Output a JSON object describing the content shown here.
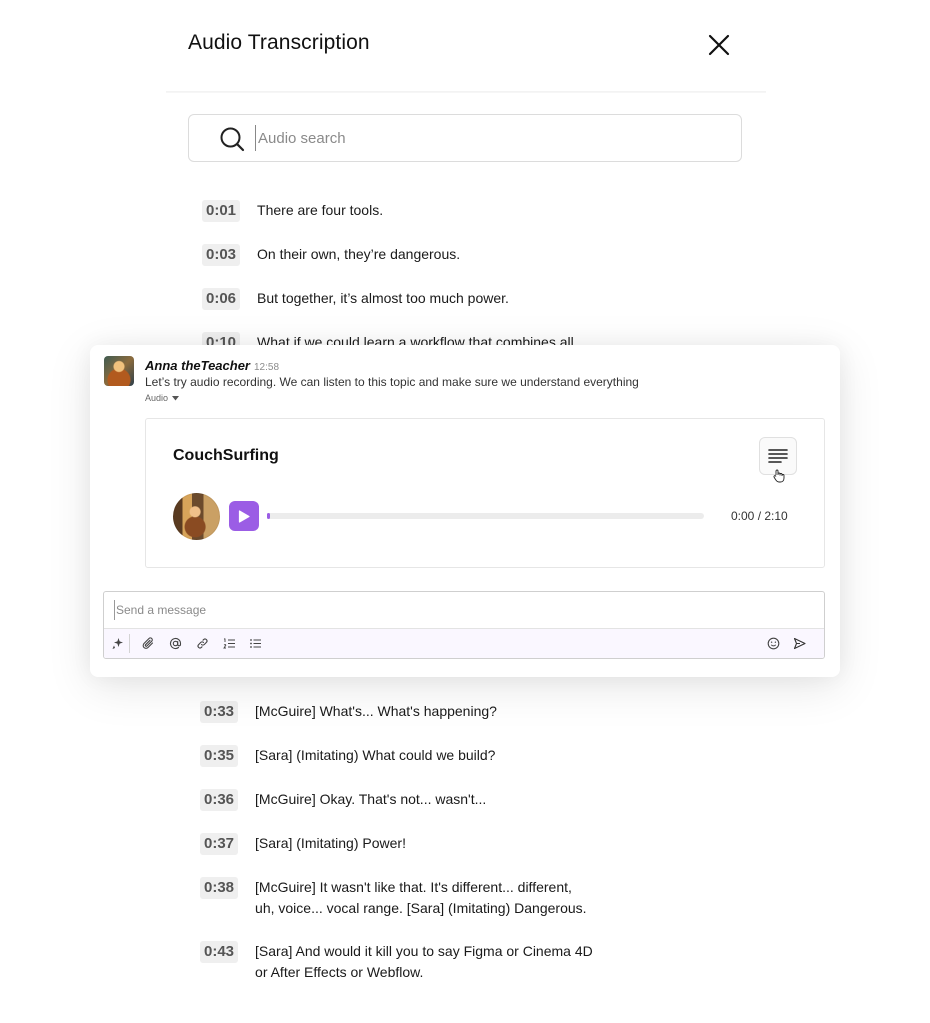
{
  "panel": {
    "title": "Audio Transcription",
    "search_placeholder": "Audio search"
  },
  "transcript_top": [
    {
      "time": "0:01",
      "text": "There are four tools."
    },
    {
      "time": "0:03",
      "text": "On their own, they’re dangerous."
    },
    {
      "time": "0:06",
      "text": "But together, it’s almost too much power."
    },
    {
      "time": "0:10",
      "text": "What if we could learn a workflow that combines all"
    }
  ],
  "transcript_bottom": [
    {
      "time": "0:33",
      "text": "[McGuire] What's... What's happening?"
    },
    {
      "time": "0:35",
      "text": "[Sara] (Imitating) What could we build?"
    },
    {
      "time": "0:36",
      "text": "[McGuire] Okay. That's not... wasn't..."
    },
    {
      "time": "0:37",
      "text": "[Sara] (Imitating) Power!"
    },
    {
      "time": "0:38",
      "text": "[McGuire] It wasn't like that. It's different... different, uh, voice... vocal range. [Sara] (Imitating) Dangerous."
    },
    {
      "time": "0:43",
      "text": "[Sara] And would it kill you to say Figma or Cinema 4D or After Effects or Webflow."
    }
  ],
  "message": {
    "author": "Anna theTeacher",
    "time": "12:58",
    "text": "Let’s try audio recording. We can listen to this topic and make sure we understand everything",
    "attachment_label": "Audio"
  },
  "player": {
    "title": "CouchSurfing",
    "time_display": "0:00 / 2:10",
    "progress": 0
  },
  "composer": {
    "placeholder": "Send a message"
  },
  "colors": {
    "accent": "#9b5de5",
    "timestamp_bg": "#efefef"
  },
  "icons": {
    "close": "close-icon",
    "search": "search-icon",
    "transcript": "lines-icon",
    "play": "play-icon",
    "toolbar": [
      "sparkle-icon",
      "paperclip-icon",
      "at-icon",
      "link-icon",
      "ordered-list-icon",
      "bullet-list-icon",
      "emoji-icon",
      "send-icon"
    ]
  }
}
